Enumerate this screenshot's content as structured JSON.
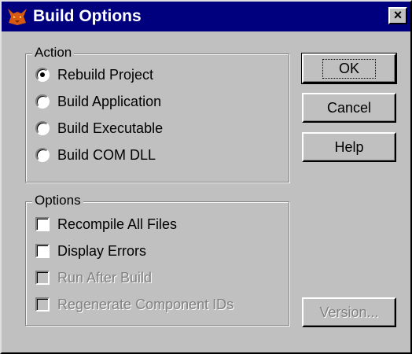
{
  "window": {
    "title": "Build Options",
    "close_label": "×"
  },
  "action": {
    "label": "Action",
    "options": [
      {
        "label": "Rebuild Project",
        "selected": true
      },
      {
        "label": "Build Application",
        "selected": false
      },
      {
        "label": "Build Executable",
        "selected": false
      },
      {
        "label": "Build COM DLL",
        "selected": false
      }
    ]
  },
  "options": {
    "label": "Options",
    "items": [
      {
        "label": "Recompile All Files",
        "checked": false,
        "enabled": true
      },
      {
        "label": "Display Errors",
        "checked": false,
        "enabled": true
      },
      {
        "label": "Run After Build",
        "checked": false,
        "enabled": false
      },
      {
        "label": "Regenerate Component IDs",
        "checked": false,
        "enabled": false
      }
    ]
  },
  "buttons": {
    "ok": "OK",
    "cancel": "Cancel",
    "help": "Help",
    "version": "Version..."
  },
  "colors": {
    "titlebar": "#00007f",
    "face": "#c0c0c0",
    "disabled_text": "#808080"
  }
}
